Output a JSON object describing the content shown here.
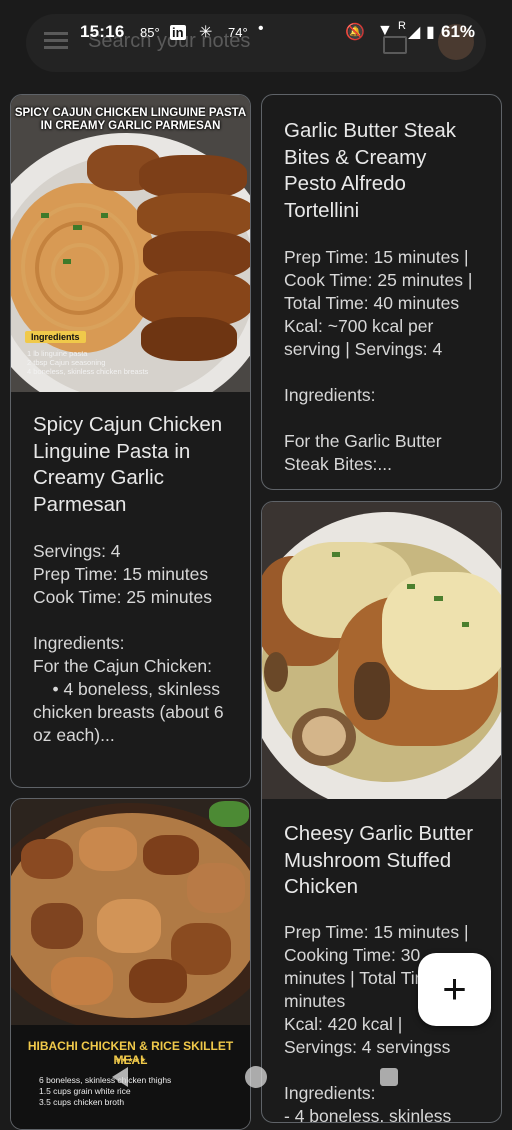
{
  "status_bar": {
    "time": "15:16",
    "temp1": "85°",
    "temp2": "74°",
    "battery": "61%"
  },
  "search": {
    "placeholder": "Search your notes"
  },
  "notes": [
    {
      "image_caption": "SPICY CAJUN CHICKEN LINGUINE PASTA IN CREAMY GARLIC PARMESAN",
      "image_ingredients_label": "Ingredients",
      "image_lines": [
        "1 lb linguine pasta",
        "2 tbsp Cajun seasoning",
        "4 boneless, skinless chicken breasts"
      ],
      "title": "Spicy Cajun Chicken Linguine Pasta in Creamy Garlic Parmesan",
      "body": "Servings: 4\nPrep Time: 15 minutes\nCook Time: 25 minutes\n\nIngredients:\nFor the Cajun Chicken:\n    • 4 boneless, skinless chicken breasts (about 6 oz each)..."
    },
    {
      "title": "Garlic Butter Steak Bites & Creamy Pesto Alfredo Tortellini",
      "body": "Prep Time: 15 minutes | Cook Time: 25 minutes | Total Time: 40 minutes\nKcal: ~700 kcal per serving | Servings: 4\n\nIngredients:\n\nFor the Garlic Butter Steak Bites:..."
    },
    {
      "title": "Cheesy Garlic Butter Mushroom Stuffed Chicken",
      "body": "Prep Time: 15 minutes | Cooking Time: 30 minutes | Total Time: 45 minutes\nKcal: 420 kcal | Servings: 4 servingss\n\nIngredients:\n- 4 boneless, skinless"
    },
    {
      "image_caption": "HIBACHI CHICKEN & RICE SKILLET MEAL",
      "image_lines": [
        "6 boneless, skinless chicken thighs",
        "1.5 cups grain white rice",
        "3.5 cups chicken broth"
      ]
    }
  ],
  "colors": {
    "background": "#1b1b1b",
    "card_border": "#5f6368",
    "caption_gold": "#f0c94a"
  }
}
